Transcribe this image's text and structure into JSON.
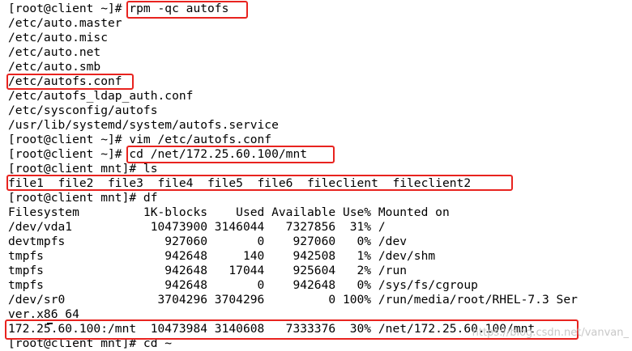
{
  "terminal": {
    "lines": [
      "[root@client ~]# rpm -qc autofs",
      "/etc/auto.master",
      "/etc/auto.misc",
      "/etc/auto.net",
      "/etc/auto.smb",
      "/etc/autofs.conf",
      "/etc/autofs_ldap_auth.conf",
      "/etc/sysconfig/autofs",
      "/usr/lib/systemd/system/autofs.service",
      "[root@client ~]# vim /etc/autofs.conf",
      "[root@client ~]# cd /net/172.25.60.100/mnt",
      "[root@client mnt]# ls",
      "file1  file2  file3  file4  file5  file6  fileclient  fileclient2",
      "[root@client mnt]# df",
      "Filesystem         1K-blocks    Used Available Use% Mounted on",
      "/dev/vda1           10473900 3146044   7327856  31% /",
      "devtmpfs              927060       0    927060   0% /dev",
      "tmpfs                 942648     140    942508   1% /dev/shm",
      "tmpfs                 942648   17044    925604   2% /run",
      "tmpfs                 942648       0    942648   0% /sys/fs/cgroup",
      "/dev/sr0             3704296 3704296         0 100% /run/media/root/RHEL-7.3 Ser",
      "ver.x86_64",
      "172.25.60.100:/mnt  10473984 3140608   7333376  30% /net/172.25.60.100/mnt",
      "[root@client mnt]# cd ~"
    ],
    "watermark": "https://blog.csdn.net/vanvan_"
  },
  "colors": {
    "background": "#ffffff",
    "text": "#000000",
    "highlight_box": "#e8231f"
  }
}
